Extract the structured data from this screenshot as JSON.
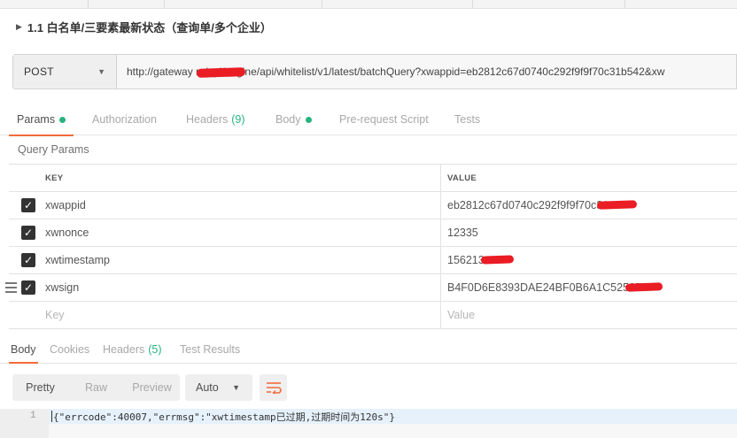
{
  "request": {
    "title": "1.1 白名单/三要素最新状态（查询单/多个企业）",
    "method": "POST",
    "url": "http://gateway        m/api/engine/api/whitelist/v1/latest/batchQuery?xwappid=eb2812c67d0740c292f9f9f70c31b542&xw"
  },
  "request_tabs": [
    {
      "label": "Params",
      "active": true,
      "indicator": "dot"
    },
    {
      "label": "Authorization"
    },
    {
      "label": "Headers",
      "count": "(9)"
    },
    {
      "label": "Body",
      "indicator": "dot"
    },
    {
      "label": "Pre-request Script"
    },
    {
      "label": "Tests"
    }
  ],
  "query_params": {
    "title": "Query Params",
    "columns": {
      "key": "KEY",
      "value": "VALUE"
    },
    "rows": [
      {
        "key": "xwappid",
        "value": "eb2812c67d0740c292f9f9f70c31",
        "checked": true
      },
      {
        "key": "xwnonce",
        "value": "12335",
        "checked": true
      },
      {
        "key": "xwtimestamp",
        "value": "156213",
        "checked": true
      },
      {
        "key": "xwsign",
        "value": "B4F0D6E8393DAE24BF0B6A1C5252D",
        "checked": true
      }
    ],
    "placeholder": {
      "key": "Key",
      "value": "Value"
    }
  },
  "response_tabs": [
    {
      "label": "Body",
      "active": true
    },
    {
      "label": "Cookies"
    },
    {
      "label": "Headers",
      "count": "(5)"
    },
    {
      "label": "Test Results"
    }
  ],
  "response_toolbar": {
    "formats": [
      "Pretty",
      "Raw",
      "Preview"
    ],
    "active_format": "Pretty",
    "language": "Auto",
    "wrap_icon": "wrap-lines-icon"
  },
  "response_body": {
    "line_number": "1",
    "content": "{\"errcode\":40007,\"errmsg\":\"xwtimestamp已过期,过期时间为120s\"}"
  },
  "colors": {
    "accent": "#f26b3a",
    "success": "#26b47f",
    "redaction": "#ea1c24"
  }
}
